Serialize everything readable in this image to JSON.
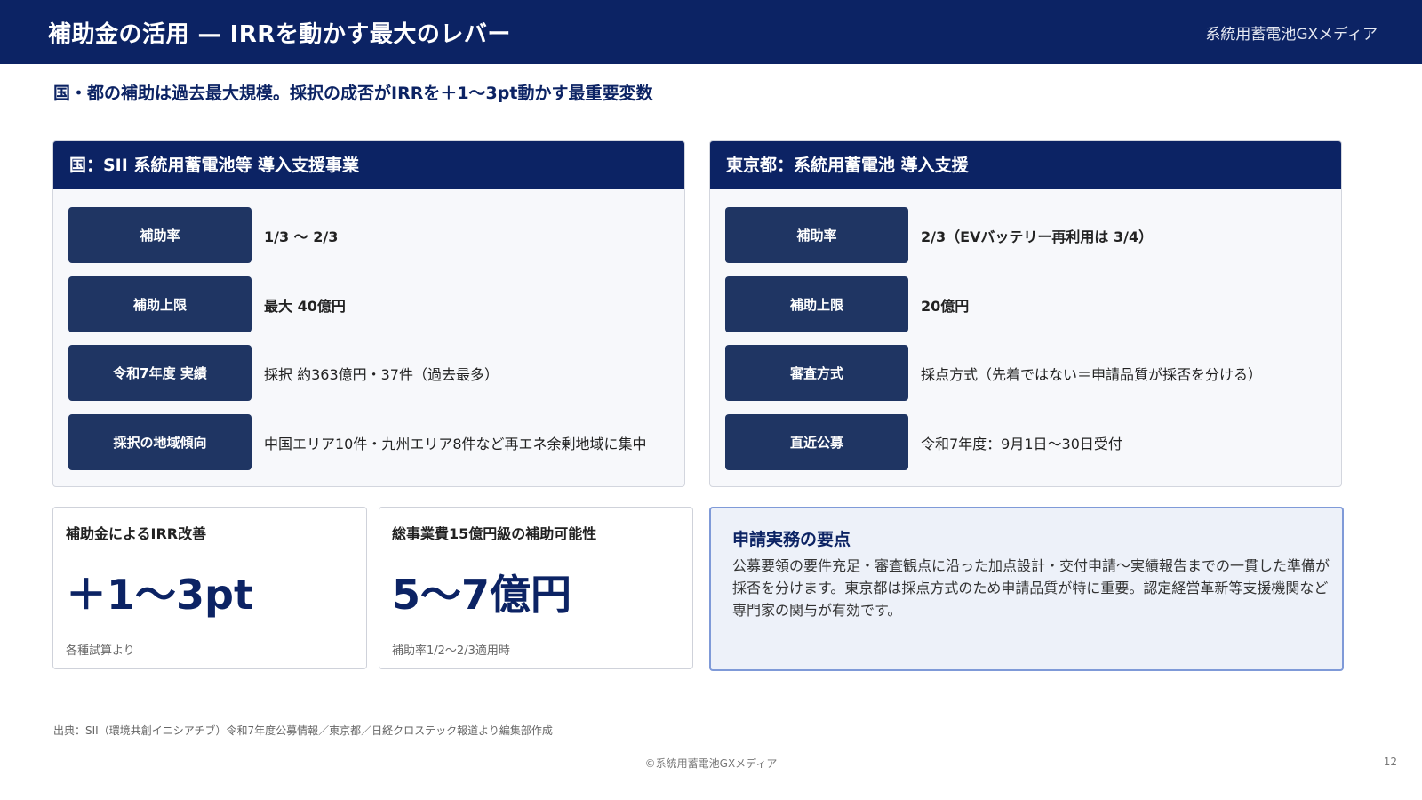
{
  "header": {
    "title": "補助金の活用 — IRRを動かす最大のレバー",
    "brand": "系統用蓄電池GXメディア"
  },
  "subtitle": "国・都の補助は過去最大規模。採択の成否がIRRを＋1〜3pt動かす最重要変数",
  "panels": [
    {
      "title": "国：SII 系統用蓄電池等 導入支援事業",
      "rows": [
        {
          "label": "補助率",
          "value": "1/3 〜 2/3",
          "bold": true
        },
        {
          "label": "補助上限",
          "value": "最大 40億円",
          "bold": true
        },
        {
          "label": "令和7年度 実績",
          "value": "採択 約363億円・37件（過去最多）",
          "bold": false
        },
        {
          "label": "採択の地域傾向",
          "value": "中国エリア10件・九州エリア8件など再エネ余剰地域に集中",
          "bold": false
        }
      ]
    },
    {
      "title": "東京都：系統用蓄電池 導入支援",
      "rows": [
        {
          "label": "補助率",
          "value": "2/3（EVバッテリー再利用は 3/4）",
          "bold": true
        },
        {
          "label": "補助上限",
          "value": "20億円",
          "bold": true
        },
        {
          "label": "審査方式",
          "value": "採点方式（先着ではない＝申請品質が採否を分ける）",
          "bold": false
        },
        {
          "label": "直近公募",
          "value": "令和7年度：9月1日〜30日受付",
          "bold": false
        }
      ]
    }
  ],
  "cards": [
    {
      "title": "補助金によるIRR改善",
      "value": "＋1〜3pt",
      "note": "各種試算より"
    },
    {
      "title": "総事業費15億円級の補助可能性",
      "value": "5〜7億円",
      "note": "補助率1/2〜2/3適用時"
    }
  ],
  "tips": {
    "title": "申請実務の要点",
    "body": "公募要領の要件充足・審査観点に沿った加点設計・交付申請〜実績報告までの一貫した準備が採否を分けます。東京都は採点方式のため申請品質が特に重要。認定経営革新等支援機関など専門家の関与が有効です。"
  },
  "source": "出典：SII（環境共創イニシアチブ）令和7年度公募情報／東京都／日経クロステック報道より編集部作成",
  "footer": "©系統用蓄電池GXメディア",
  "page_number": "12",
  "colors": {
    "navy": "#0c2364",
    "label_bg": "#1f3563",
    "tips_border": "#7f9ad8",
    "tips_bg": "#edf1f9"
  }
}
